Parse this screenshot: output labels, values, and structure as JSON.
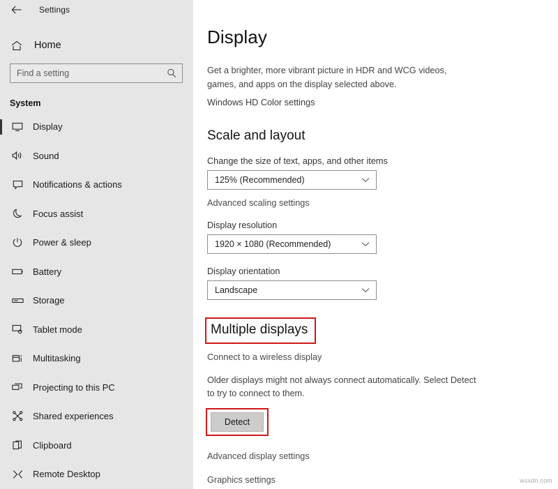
{
  "window": {
    "app_title": "Settings",
    "back_icon": "back-arrow-icon"
  },
  "sidebar": {
    "home": {
      "label": "Home",
      "icon": "home-icon"
    },
    "search": {
      "placeholder": "Find a setting",
      "value": "",
      "icon": "search-icon"
    },
    "section_label": "System",
    "items": [
      {
        "label": "Display",
        "icon": "monitor-icon",
        "selected": true
      },
      {
        "label": "Sound",
        "icon": "speaker-icon",
        "selected": false
      },
      {
        "label": "Notifications & actions",
        "icon": "notification-icon",
        "selected": false
      },
      {
        "label": "Focus assist",
        "icon": "moon-icon",
        "selected": false
      },
      {
        "label": "Power & sleep",
        "icon": "power-icon",
        "selected": false
      },
      {
        "label": "Battery",
        "icon": "battery-icon",
        "selected": false
      },
      {
        "label": "Storage",
        "icon": "storage-icon",
        "selected": false
      },
      {
        "label": "Tablet mode",
        "icon": "tablet-icon",
        "selected": false
      },
      {
        "label": "Multitasking",
        "icon": "multitasking-icon",
        "selected": false
      },
      {
        "label": "Projecting to this PC",
        "icon": "projecting-icon",
        "selected": false
      },
      {
        "label": "Shared experiences",
        "icon": "share-icon",
        "selected": false
      },
      {
        "label": "Clipboard",
        "icon": "clipboard-icon",
        "selected": false
      },
      {
        "label": "Remote Desktop",
        "icon": "remote-desktop-icon",
        "selected": false
      }
    ]
  },
  "main": {
    "page_title": "Display",
    "hdr_description": "Get a brighter, more vibrant picture in HDR and WCG videos, games, and apps on the display selected above.",
    "hd_color_link": "Windows HD Color settings",
    "scale_section": {
      "heading": "Scale and layout",
      "scale_label": "Change the size of text, apps, and other items",
      "scale_value": "125% (Recommended)",
      "advanced_scaling_link": "Advanced scaling settings",
      "resolution_label": "Display resolution",
      "resolution_value": "1920 × 1080 (Recommended)",
      "orientation_label": "Display orientation",
      "orientation_value": "Landscape"
    },
    "multiple_displays": {
      "heading": "Multiple displays",
      "wireless_link": "Connect to a wireless display",
      "description": "Older displays might not always connect automatically. Select Detect to try to connect to them.",
      "detect_button": "Detect"
    },
    "footer_links": {
      "advanced_display": "Advanced display settings",
      "graphics": "Graphics settings"
    }
  },
  "annotations": {
    "highlight_color": "#d01818"
  },
  "watermark": "wsxdn.com"
}
